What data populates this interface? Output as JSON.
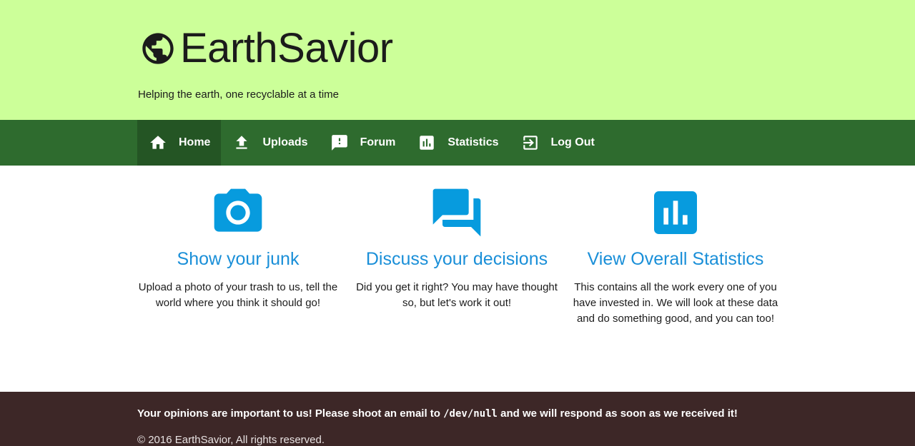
{
  "header": {
    "brand_name": "EarthSavior",
    "brand_icon": "globe-icon",
    "tagline": "Helping the earth, one recyclable at a time",
    "background_color": "#ccff99"
  },
  "nav": {
    "background_color": "#2e6b2e",
    "items": [
      {
        "label": "Home",
        "icon": "home-icon",
        "active": true
      },
      {
        "label": "Uploads",
        "icon": "upload-icon",
        "active": false
      },
      {
        "label": "Forum",
        "icon": "feedback-icon",
        "active": false
      },
      {
        "label": "Statistics",
        "icon": "bar-chart-icon",
        "active": false
      },
      {
        "label": "Log Out",
        "icon": "exit-icon",
        "active": false
      }
    ]
  },
  "features": [
    {
      "icon": "camera-icon",
      "title": "Show your junk",
      "text": "Upload a photo of your trash to us, tell the world where you think it should go!"
    },
    {
      "icon": "forum-icon",
      "title": "Discuss your decisions",
      "text": "Did you get it right? You may have thought so, but let's work it out!"
    },
    {
      "icon": "statistics-icon",
      "title": "View Overall Statistics",
      "text": "This contains all the work every one of you have invested in. We will look at these data and do something good, and you can too!"
    }
  ],
  "accent_color": "#079bde",
  "footer": {
    "message_before": "Your opinions are important to us! Please shoot an email to ",
    "email": "/dev/null",
    "message_after": " and we will respond as soon as we received it!",
    "copyright": "© 2016 EarthSavior, All rights reserved.",
    "background_color": "#3d2727"
  }
}
